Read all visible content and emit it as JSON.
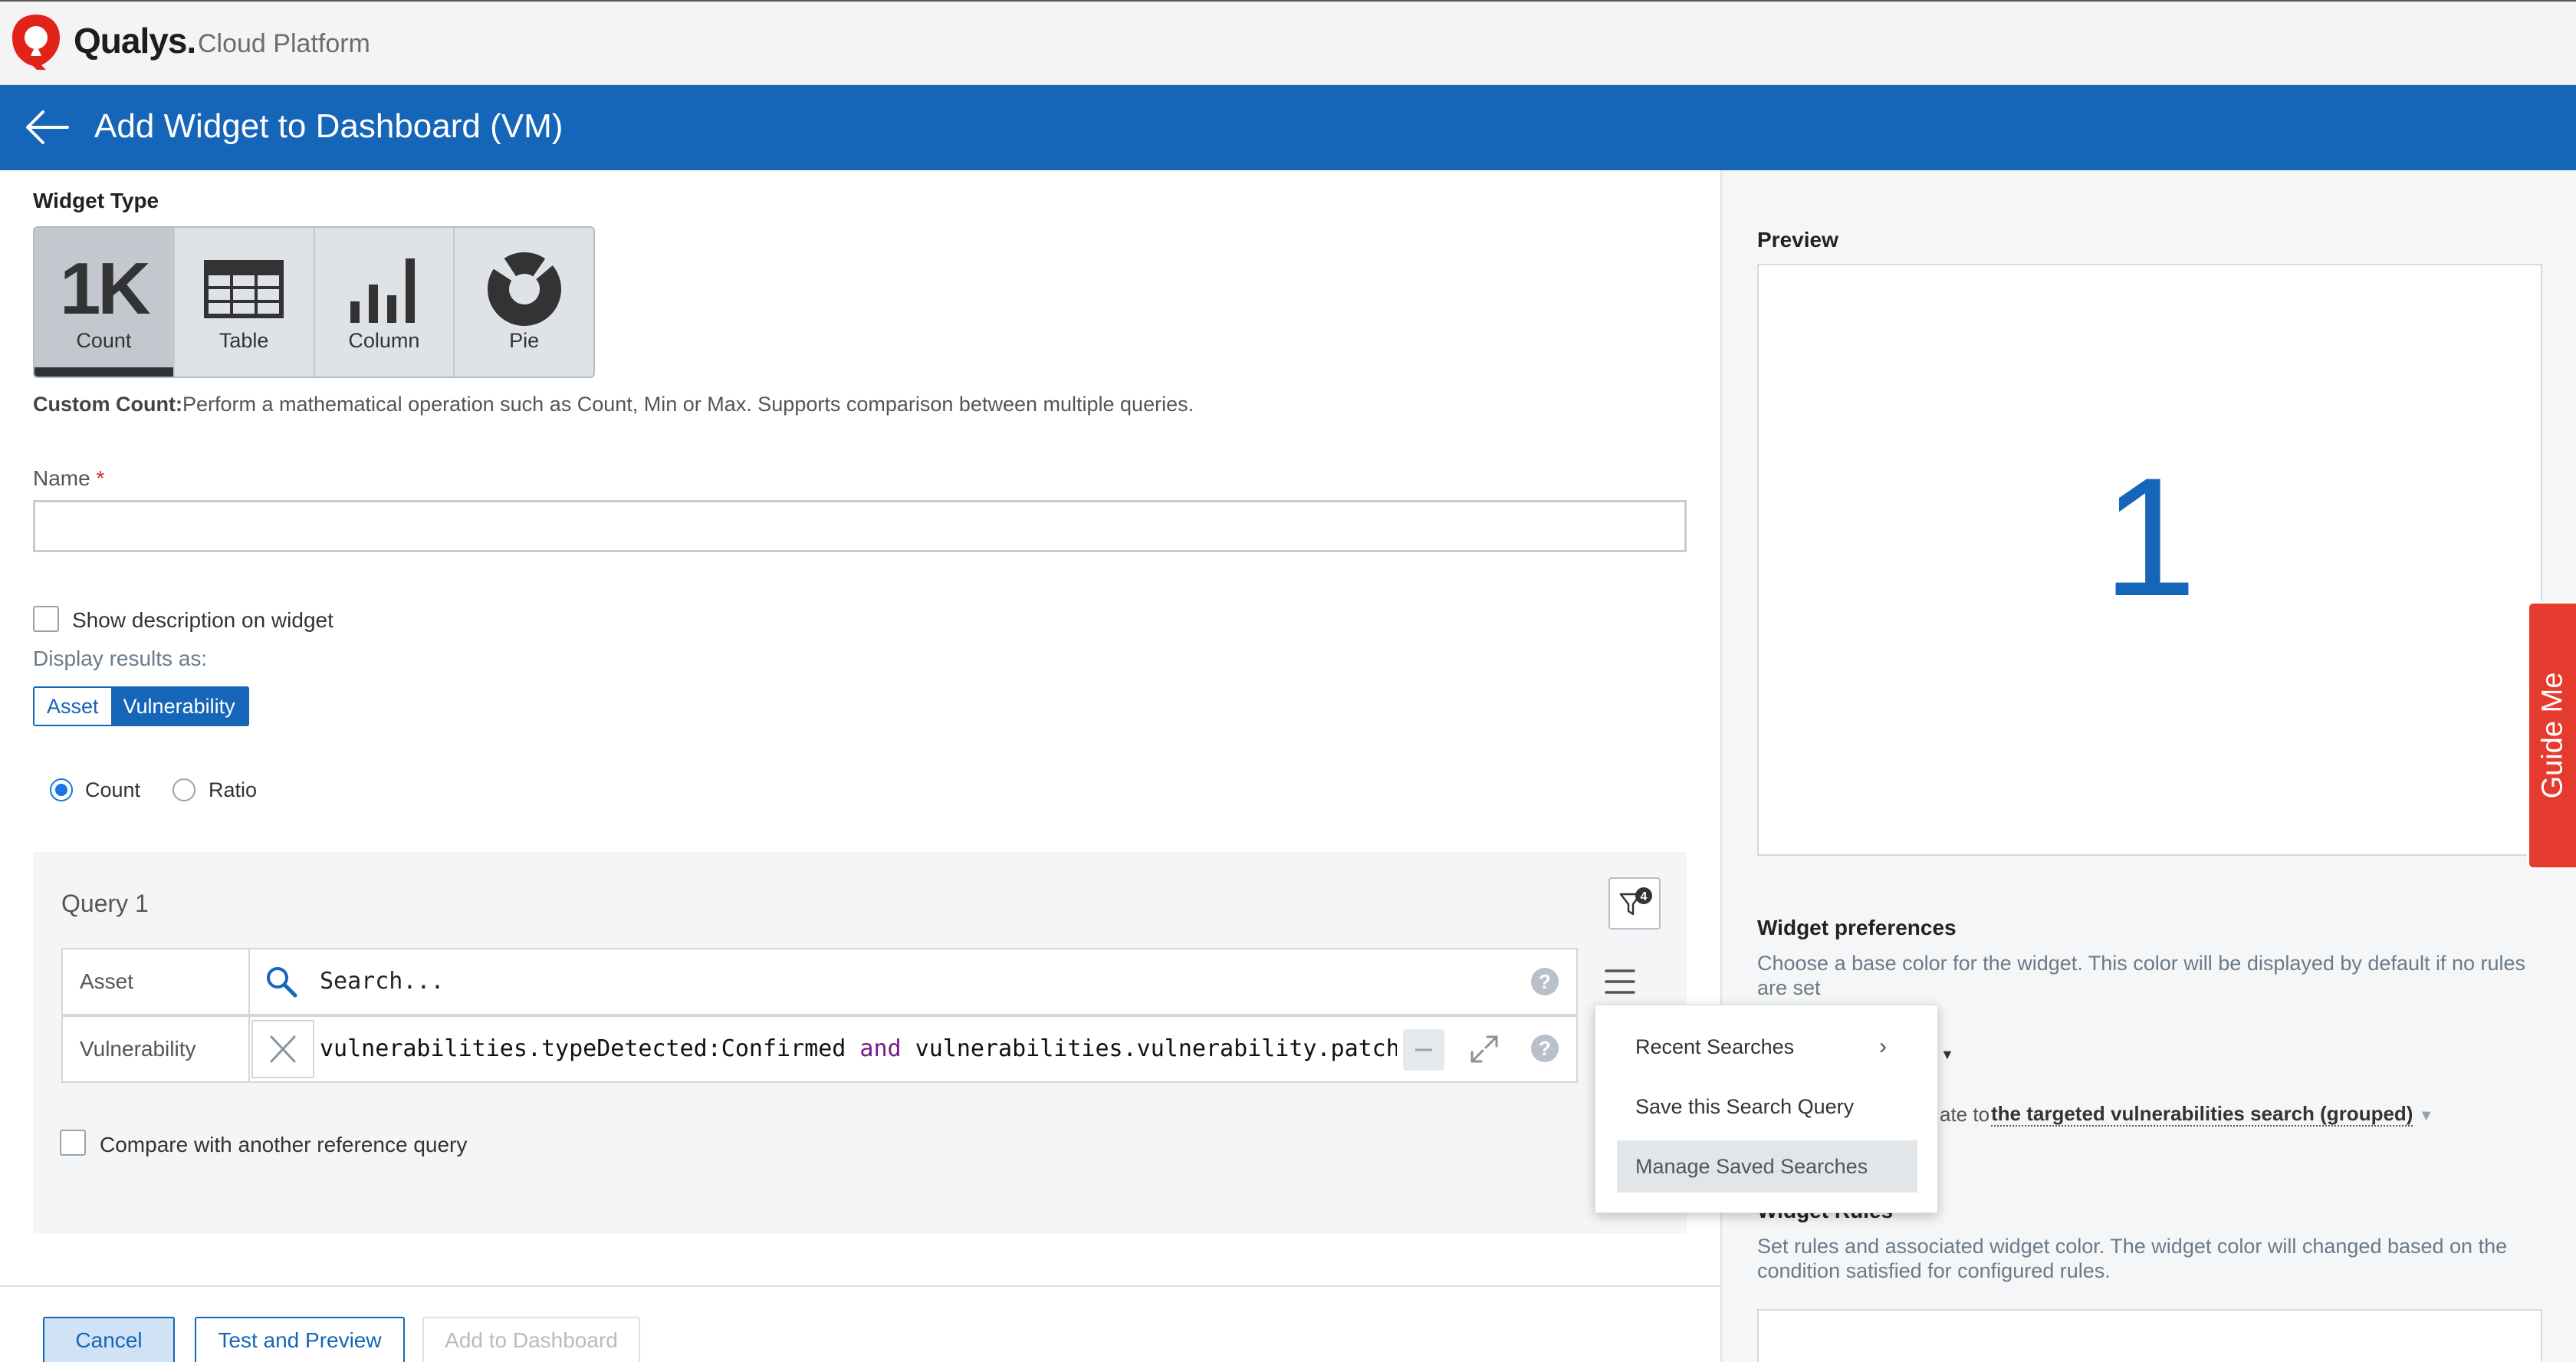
{
  "app": {
    "brand": "Qualys.",
    "brand_sub": "Cloud Platform"
  },
  "header": {
    "title": "Add Widget to Dashboard (VM)"
  },
  "widget_type": {
    "label": "Widget Type",
    "types": [
      {
        "label": "Count",
        "icon": "count-1k-icon",
        "glyph": "1K",
        "active": true
      },
      {
        "label": "Table",
        "icon": "table-icon",
        "active": false
      },
      {
        "label": "Column",
        "icon": "column-chart-icon",
        "active": false
      },
      {
        "label": "Pie",
        "icon": "pie-chart-icon",
        "active": false
      }
    ],
    "desc_bold": "Custom Count:",
    "desc": "Perform a mathematical operation such as Count, Min or Max. Supports comparison between multiple queries."
  },
  "name_field": {
    "label": "Name",
    "required_mark": "*",
    "value": ""
  },
  "show_description": {
    "label": "Show description on widget",
    "checked": false
  },
  "display_results": {
    "label": "Display results as:",
    "options": [
      "Asset",
      "Vulnerability"
    ],
    "selected": "Vulnerability"
  },
  "mode": {
    "options": [
      "Count",
      "Ratio"
    ],
    "selected": "Count"
  },
  "query": {
    "title": "Query 1",
    "filter_badge": "4",
    "asset_label": "Asset",
    "search_placeholder": "Search...",
    "vuln_label": "Vulnerability",
    "vuln_query_part1": "vulnerabilities.typeDetected:Confirmed ",
    "vuln_query_kw": "and",
    "vuln_query_part2": " vulnerabilities.vulnerability.patchRe",
    "help": "?",
    "compare_label": "Compare with another reference query"
  },
  "menu": {
    "items": [
      "Recent Searches",
      "Save this Search Query",
      "Manage Saved Searches"
    ]
  },
  "footer": {
    "cancel": "Cancel",
    "test": "Test and Preview",
    "add": "Add to Dashboard"
  },
  "preview": {
    "label": "Preview",
    "value": "1"
  },
  "guide": {
    "label": "Guide Me"
  },
  "preferences": {
    "title": "Widget preferences",
    "desc": "Choose a base color for the widget. This color will be displayed by default if no rules are set",
    "navigate_prefix": "ate to",
    "navigate_link": "the targeted vulnerabilities search (grouped)",
    "rules_title": "Widget Rules",
    "rules_desc": "Set rules and associated widget color. The widget color will changed based on the condition satisfied for configured rules."
  },
  "colors": {
    "header_blue": "#1565b8",
    "guide_red": "#e53b2e",
    "brand_red": "#e2231a"
  }
}
